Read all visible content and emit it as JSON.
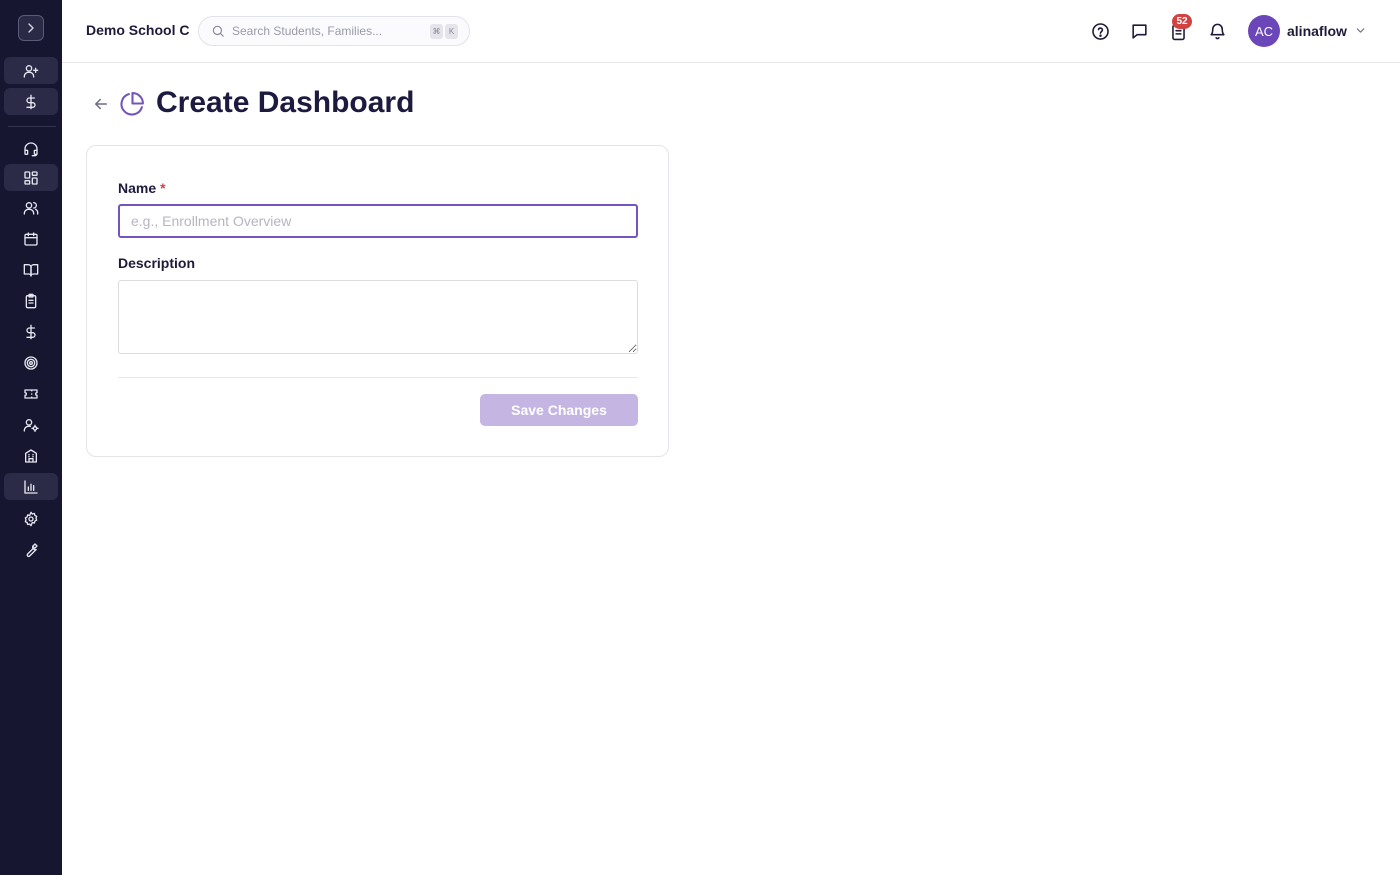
{
  "header": {
    "school_name": "Demo School C",
    "search": {
      "placeholder": "Search Students, Families...",
      "shortcut_keys": [
        "⌘",
        "K"
      ]
    },
    "icons": [
      "help-circle-icon",
      "message-icon",
      "clipboard-tasks-icon",
      "bell-icon"
    ],
    "tasks_badge": "52",
    "user": {
      "initials": "AC",
      "name": "alinaflow"
    }
  },
  "sidebar": {
    "items": [
      {
        "name": "add-user",
        "icon": "user-plus-icon"
      },
      {
        "name": "billing",
        "icon": "dollar-icon"
      },
      {
        "name": "support",
        "icon": "headset-icon"
      },
      {
        "name": "dashboard",
        "icon": "dashboard-icon",
        "active": true
      },
      {
        "name": "people",
        "icon": "users-icon"
      },
      {
        "name": "calendar",
        "icon": "calendar-icon"
      },
      {
        "name": "curriculum",
        "icon": "book-icon"
      },
      {
        "name": "assessments",
        "icon": "clipboard-icon"
      },
      {
        "name": "finance",
        "icon": "dollar-icon"
      },
      {
        "name": "goals",
        "icon": "target-icon"
      },
      {
        "name": "tickets",
        "icon": "ticket-icon"
      },
      {
        "name": "user-settings",
        "icon": "user-gear-icon"
      },
      {
        "name": "school",
        "icon": "building-icon"
      },
      {
        "name": "reports",
        "icon": "bar-chart-icon",
        "active": true
      },
      {
        "name": "settings",
        "icon": "gear-icon"
      },
      {
        "name": "tools",
        "icon": "wrench-icon"
      }
    ]
  },
  "page": {
    "title": "Create Dashboard",
    "title_icon": "pie-chart-icon"
  },
  "form": {
    "name_label": "Name",
    "required_mark": "*",
    "name_value": "",
    "name_placeholder": "e.g., Enrollment Overview",
    "description_label": "Description",
    "description_value": "",
    "save_label": "Save Changes"
  },
  "colors": {
    "sidebar_bg": "#161630",
    "accent": "#7454bd",
    "save_disabled": "#c4b5e3",
    "badge": "#d14343",
    "avatar": "#6b46b8"
  }
}
